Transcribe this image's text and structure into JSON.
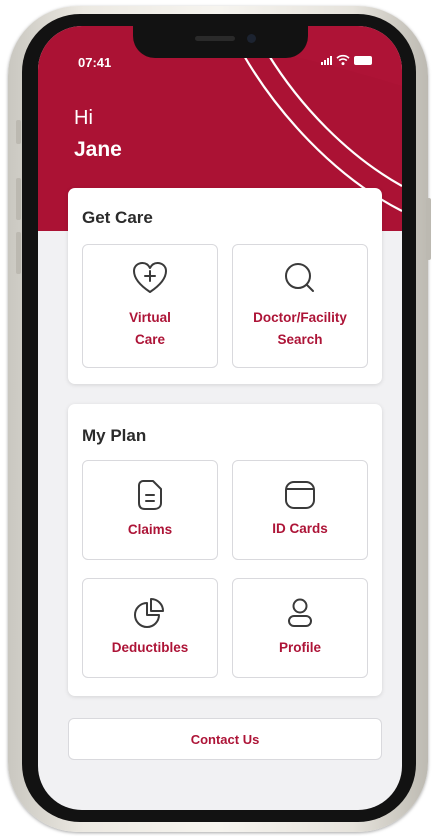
{
  "status": {
    "time": "07:41"
  },
  "greeting": {
    "hi": "Hi",
    "name": "Jane"
  },
  "get_care": {
    "title": "Get Care",
    "tiles": [
      {
        "label": "Virtual\nCare",
        "icon": "heart-plus-icon"
      },
      {
        "label": "Doctor/Facility\nSearch",
        "icon": "search-icon"
      }
    ]
  },
  "my_plan": {
    "title": "My Plan",
    "tiles": [
      {
        "label": "Claims",
        "icon": "document-icon"
      },
      {
        "label": "ID Cards",
        "icon": "card-icon"
      },
      {
        "label": "Deductibles",
        "icon": "pie-chart-icon"
      },
      {
        "label": "Profile",
        "icon": "user-icon"
      }
    ]
  },
  "contact_label": "Contact Us",
  "colors": {
    "brand": "#ab1234",
    "accent_text": "#ad1437",
    "background": "#f1f1f3"
  }
}
